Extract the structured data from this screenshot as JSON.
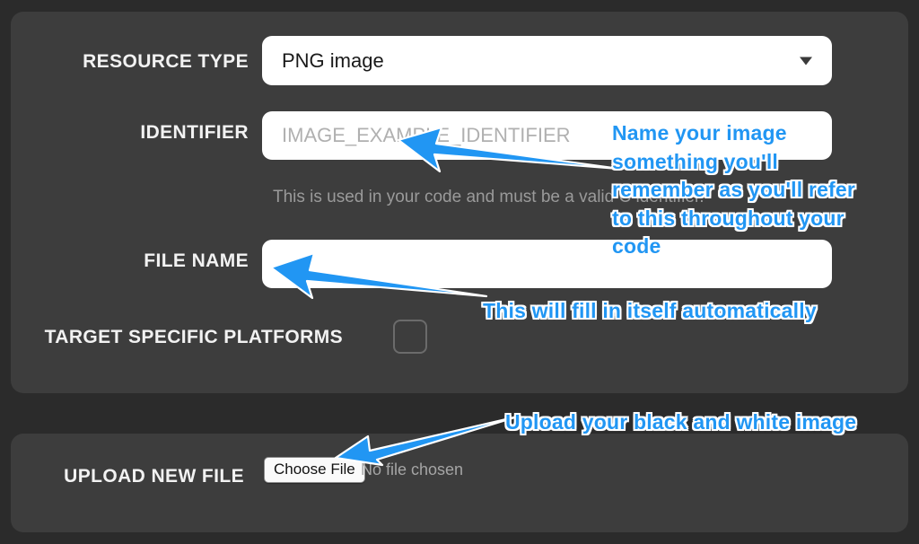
{
  "theme": {
    "page_background": "#2b2b2b",
    "panel_background": "#3d3d3d",
    "label_color": "#f2f2f2",
    "annotation_color": "#2196f3",
    "annotation_outline": "#ffffff",
    "placeholder_color": "#b0b0b0",
    "helper_color": "#9a9a9a"
  },
  "settings_panel": {
    "resource_type": {
      "label": "RESOURCE TYPE",
      "value": "PNG image",
      "caret_icon": "chevron-down-icon"
    },
    "identifier": {
      "label": "IDENTIFIER",
      "value": "",
      "placeholder": "IMAGE_EXAMPLE_IDENTIFIER",
      "helper_text": "This is used in your code and must be a valid C identifier."
    },
    "file_name": {
      "label": "FILE NAME",
      "value": "",
      "placeholder": ""
    },
    "target_specific_platforms": {
      "label": "TARGET SPECIFIC PLATFORMS",
      "checked": false
    }
  },
  "upload_panel": {
    "label": "UPLOAD NEW FILE",
    "choose_file_button": "Choose File",
    "file_status": "No file chosen"
  },
  "annotations": [
    {
      "id": "identifier-note",
      "text": "Name your image\nsomething you'll\nremember as you'll refer\nto this throughout your\ncode"
    },
    {
      "id": "file-name-note",
      "text": "This will fill in itself automatically"
    },
    {
      "id": "upload-note",
      "text": "Upload your black and white image"
    }
  ]
}
